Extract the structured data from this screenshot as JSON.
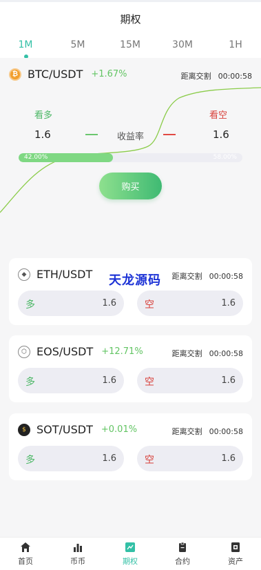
{
  "header": {
    "title": "期权"
  },
  "tabs": [
    {
      "label": "1M",
      "active": true
    },
    {
      "label": "5M",
      "active": false
    },
    {
      "label": "15M",
      "active": false
    },
    {
      "label": "30M",
      "active": false
    },
    {
      "label": "1H",
      "active": false
    }
  ],
  "hero": {
    "pair": "BTC/USDT",
    "change": "+1.67%",
    "countdown_label": "距离交割",
    "countdown": "00:00:58",
    "long_label": "看多",
    "short_label": "看空",
    "long_value": "1.6",
    "short_value": "1.6",
    "yield_label": "收益率",
    "progress_left": "42.00%",
    "progress_right": "58.00%",
    "progress_fraction": 0.42,
    "buy_label": "购买"
  },
  "cards": [
    {
      "pair": "ETH/USDT",
      "change": "",
      "countdown_label": "距离交割",
      "countdown": "00:00:58",
      "long_label": "多",
      "long_value": "1.6",
      "short_label": "空",
      "short_value": "1.6",
      "icon": "eth-icon"
    },
    {
      "pair": "EOS/USDT",
      "change": "+12.71%",
      "countdown_label": "距离交割",
      "countdown": "00:00:58",
      "long_label": "多",
      "long_value": "1.6",
      "short_label": "空",
      "short_value": "1.6",
      "icon": "eos-icon"
    },
    {
      "pair": "SOT/USDT",
      "change": "+0.01%",
      "countdown_label": "距离交割",
      "countdown": "00:00:58",
      "long_label": "多",
      "long_value": "1.6",
      "short_label": "空",
      "short_value": "1.6",
      "icon": "sot-icon"
    }
  ],
  "watermark": "天龙源码",
  "nav": [
    {
      "label": "首页",
      "icon": "home-icon",
      "active": false
    },
    {
      "label": "币币",
      "icon": "chart-bars-icon",
      "active": false
    },
    {
      "label": "期权",
      "icon": "option-icon",
      "active": true
    },
    {
      "label": "合约",
      "icon": "clipboard-icon",
      "active": false
    },
    {
      "label": "资产",
      "icon": "wallet-icon",
      "active": false
    }
  ],
  "colors": {
    "accent": "#33c0a6",
    "long": "#4cb766",
    "short": "#d8403a"
  }
}
